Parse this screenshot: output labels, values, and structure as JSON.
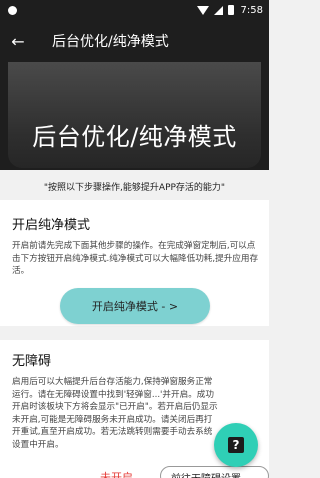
{
  "status_bar": {
    "time": "7:58",
    "icons": [
      "notification-icon",
      "wifi-icon",
      "signal-icon",
      "battery-icon"
    ]
  },
  "app_bar": {
    "back_icon": "arrow-back-icon",
    "back_glyph": "←",
    "title": "后台优化/纯净模式"
  },
  "hero": {
    "title": "后台优化/纯净模式"
  },
  "hint": "\"按照以下步骤操作,能够提升APP存活的能力\"",
  "card_pure_mode": {
    "title": "开启纯净模式",
    "description": "开启前请先完成下面其他步骤的操作。在完成弹窗定制后,可以点击下方按钮开启纯净模式.纯净模式可以大幅降低功耗,提升应用存活。",
    "button_label": "开启纯净模式 - >"
  },
  "card_accessibility": {
    "title": "无障碍",
    "description": "启用后可以大幅提升后台存活能力,保持弹窗服务正常运行。请在无障碍设置中找到'轻弹窗...'并开启。成功开启时该板块下方将会显示\"已开启\"。若开启后仍显示未开启,可能是无障碍服务未开启成功。请关闭后再打开重试,直至开启成功。若无法跳转则需要手动去系统设置中开启。",
    "status_text": "未开启",
    "button_label": "前往无障碍设置"
  },
  "fab": {
    "icon": "help-icon",
    "glyph": "?"
  },
  "colors": {
    "app_bar": "#1e1e1e",
    "primary_button": "#7ed1d1",
    "fab": "#2fcfb6",
    "status_red": "#e53935"
  }
}
